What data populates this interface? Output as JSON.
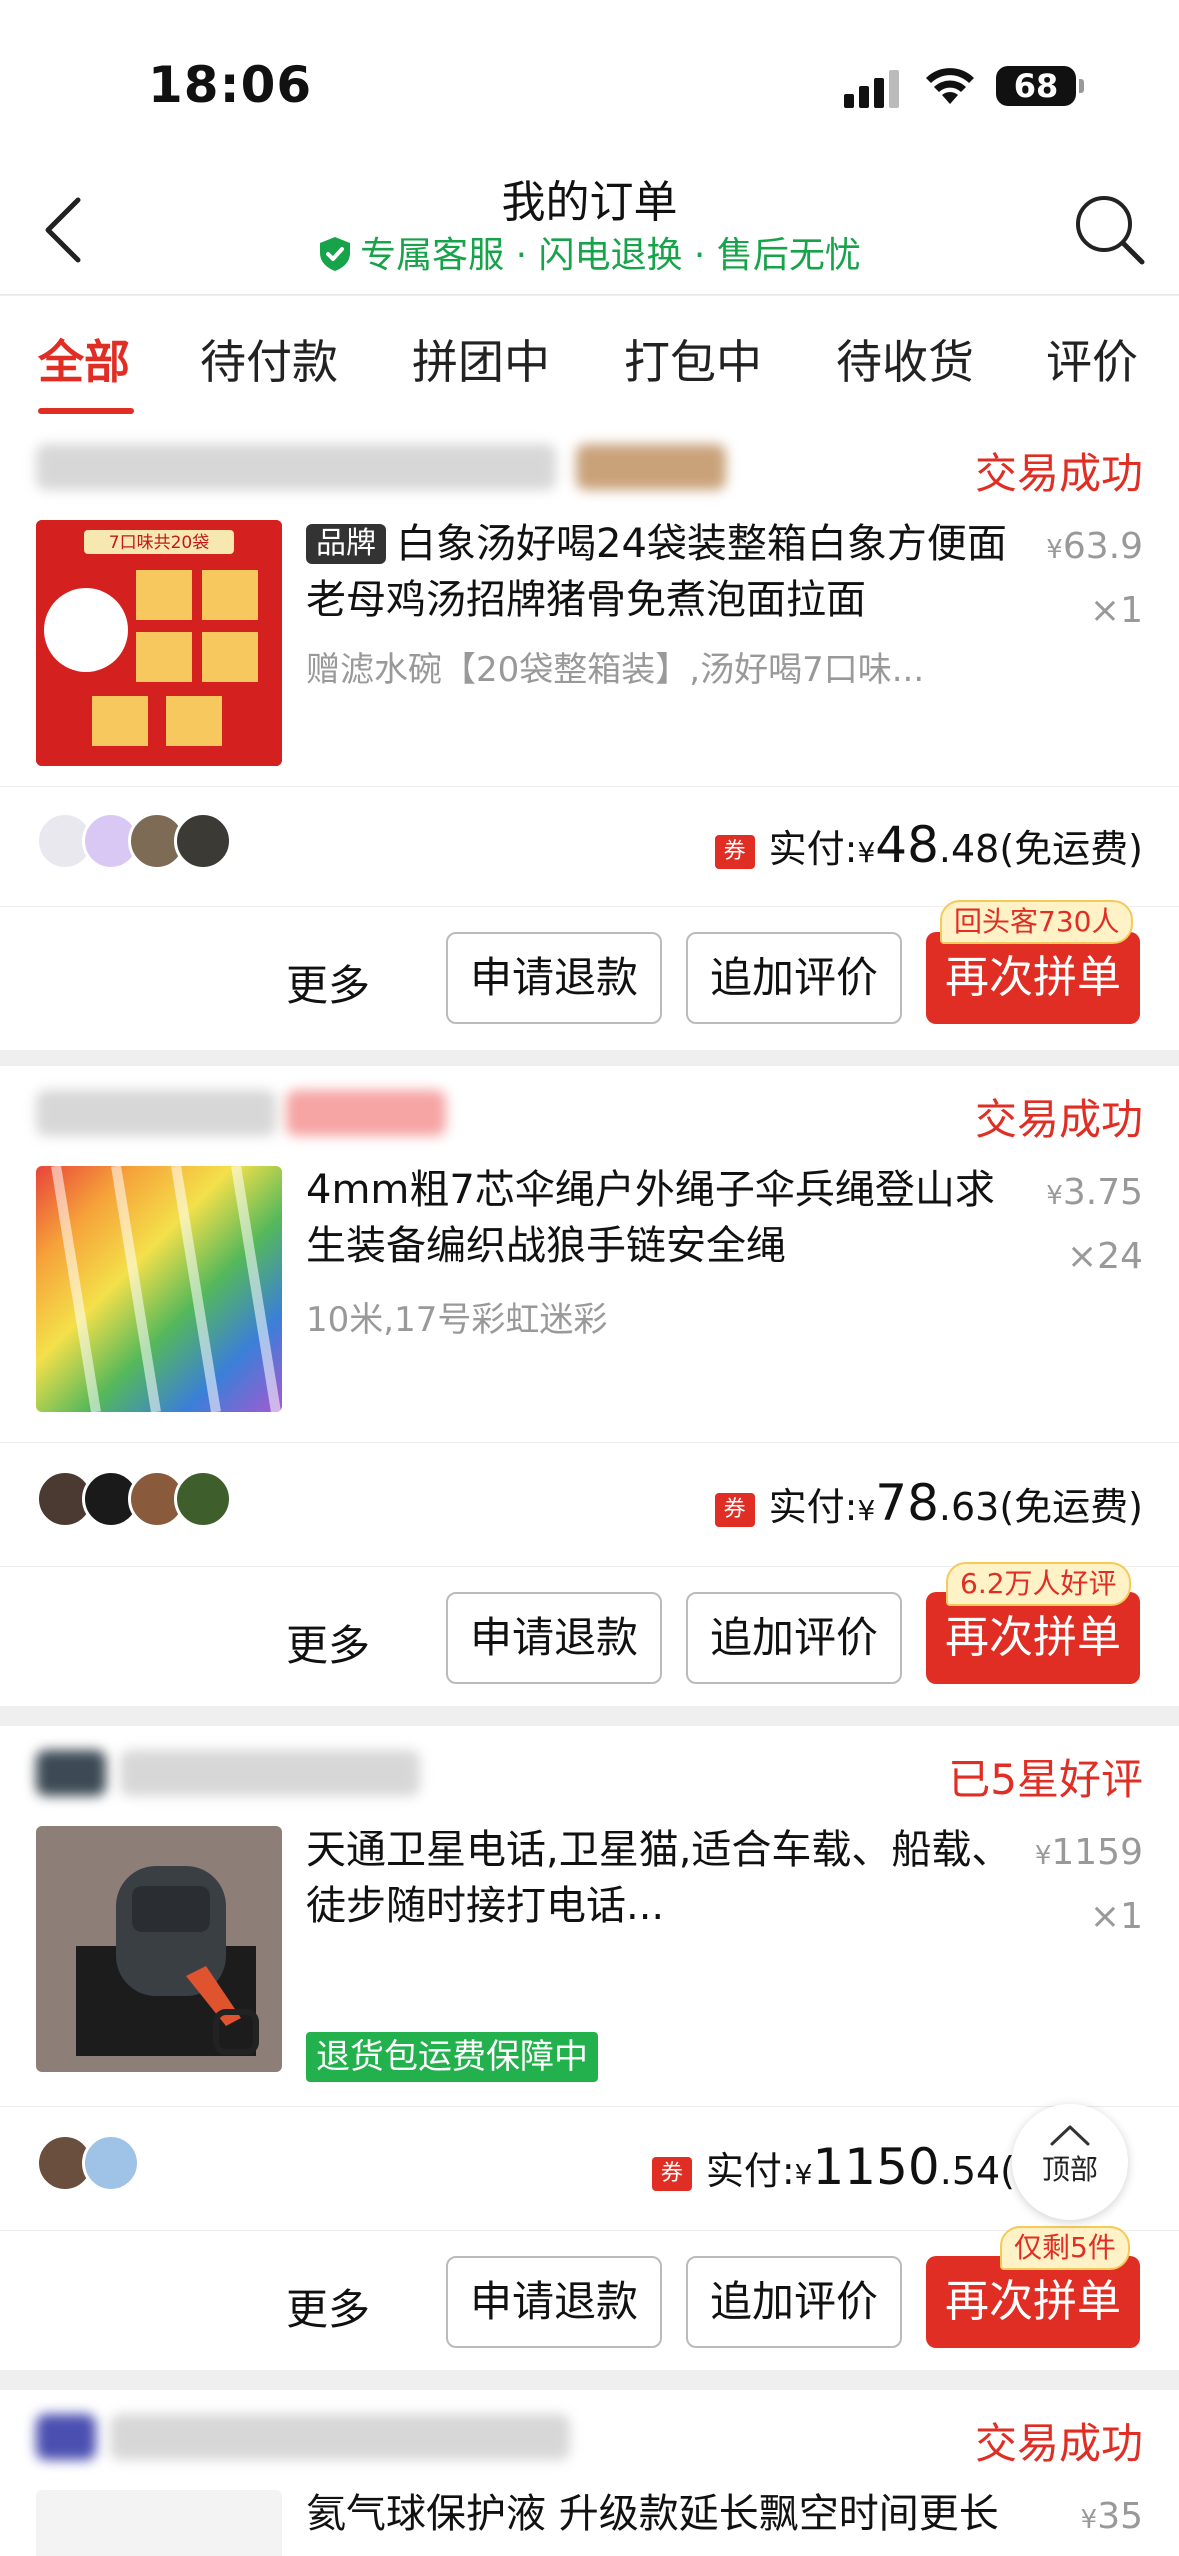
{
  "status_bar": {
    "time": "18:06",
    "battery": "68"
  },
  "header": {
    "title": "我的订单",
    "subtitle": "专属客服 · 闪电退换 · 售后无忧"
  },
  "tabs": [
    "全部",
    "待付款",
    "拼团中",
    "打包中",
    "待收货",
    "评价"
  ],
  "orders": [
    {
      "status": "交易成功",
      "brand_badge": "品牌",
      "title": "白象汤好喝24袋装整箱白象方便面老母鸡汤招牌猪骨免煮泡面拉面",
      "spec": "赠滤水碗【20袋整箱装】,汤好喝7口味...",
      "unit_price_symbol": "¥",
      "unit_price": "63.9",
      "quantity": "×1",
      "coupon": "券",
      "paid_label": "实付:",
      "paid_symbol": "¥",
      "paid_int": "48",
      "paid_dec": ".48",
      "shipping": "(免运费)",
      "more": "更多",
      "btn_refund": "申请退款",
      "btn_review": "追加评价",
      "btn_again": "再次拼单",
      "bubble": "回头客730人",
      "thumb_text": "7口味共20袋"
    },
    {
      "status": "交易成功",
      "title": "4mm粗7芯伞绳户外绳子伞兵绳登山求生装备编织战狼手链安全绳",
      "spec": "10米,17号彩虹迷彩",
      "unit_price_symbol": "¥",
      "unit_price": "3.75",
      "quantity": "×24",
      "coupon": "券",
      "paid_label": "实付:",
      "paid_symbol": "¥",
      "paid_int": "78",
      "paid_dec": ".63",
      "shipping": "(免运费)",
      "more": "更多",
      "btn_refund": "申请退款",
      "btn_review": "追加评价",
      "btn_again": "再次拼单",
      "bubble": "6.2万人好评"
    },
    {
      "status": "已5星好评",
      "title": "天通卫星电话,卫星猫,适合车载、船载、徒步随时接打电话...",
      "green_tag": "退货包运费保障中",
      "unit_price_symbol": "¥",
      "unit_price": "1159",
      "quantity": "×1",
      "coupon": "券",
      "paid_label": "实付:",
      "paid_symbol": "¥",
      "paid_int": "1150",
      "paid_dec": ".54",
      "shipping": "(",
      "more": "更多",
      "btn_refund": "申请退款",
      "btn_review": "追加评价",
      "btn_again": "再次拼单",
      "bubble": "仅剩5件"
    },
    {
      "status": "交易成功",
      "title": "氦气球保护液 升级款延长飘空时间更长",
      "unit_price_symbol": "¥",
      "unit_price": "35"
    }
  ],
  "back_to_top": "顶部",
  "colors": {
    "accent": "#e02e24",
    "green": "#17a34a",
    "badge_green": "#22b14c"
  }
}
